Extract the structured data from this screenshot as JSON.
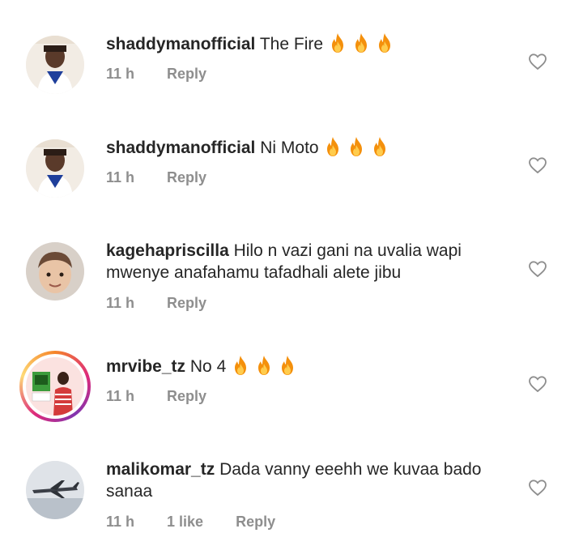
{
  "comments": [
    {
      "username": "shaddymanofficial",
      "text": "The Fire",
      "fires": 3,
      "time": "11 h",
      "reply": "Reply",
      "likes": ""
    },
    {
      "username": "shaddymanofficial",
      "text": "Ni Moto",
      "fires": 3,
      "time": "11 h",
      "reply": "Reply",
      "likes": ""
    },
    {
      "username": "kagehapriscilla",
      "text": "Hilo n vazi gani na uvalia wapi mwenye anafahamu tafadhali alete jibu",
      "fires": 0,
      "time": "11 h",
      "reply": "Reply",
      "likes": ""
    },
    {
      "username": "mrvibe_tz",
      "text": "No 4",
      "fires": 3,
      "time": "11 h",
      "reply": "Reply",
      "likes": ""
    },
    {
      "username": "malikomar_tz",
      "text": "Dada vanny eeehh we kuvaa bado sanaa",
      "fires": 0,
      "time": "11 h",
      "reply": "Reply",
      "likes": "1 like"
    }
  ],
  "icons": {
    "like": "heart-outline-icon",
    "emoji": "fire-emoji"
  },
  "colors": {
    "text": "#262626",
    "meta": "#8e8e8e",
    "ring_start": "#f58529",
    "ring_end": "#dd2a7b"
  }
}
